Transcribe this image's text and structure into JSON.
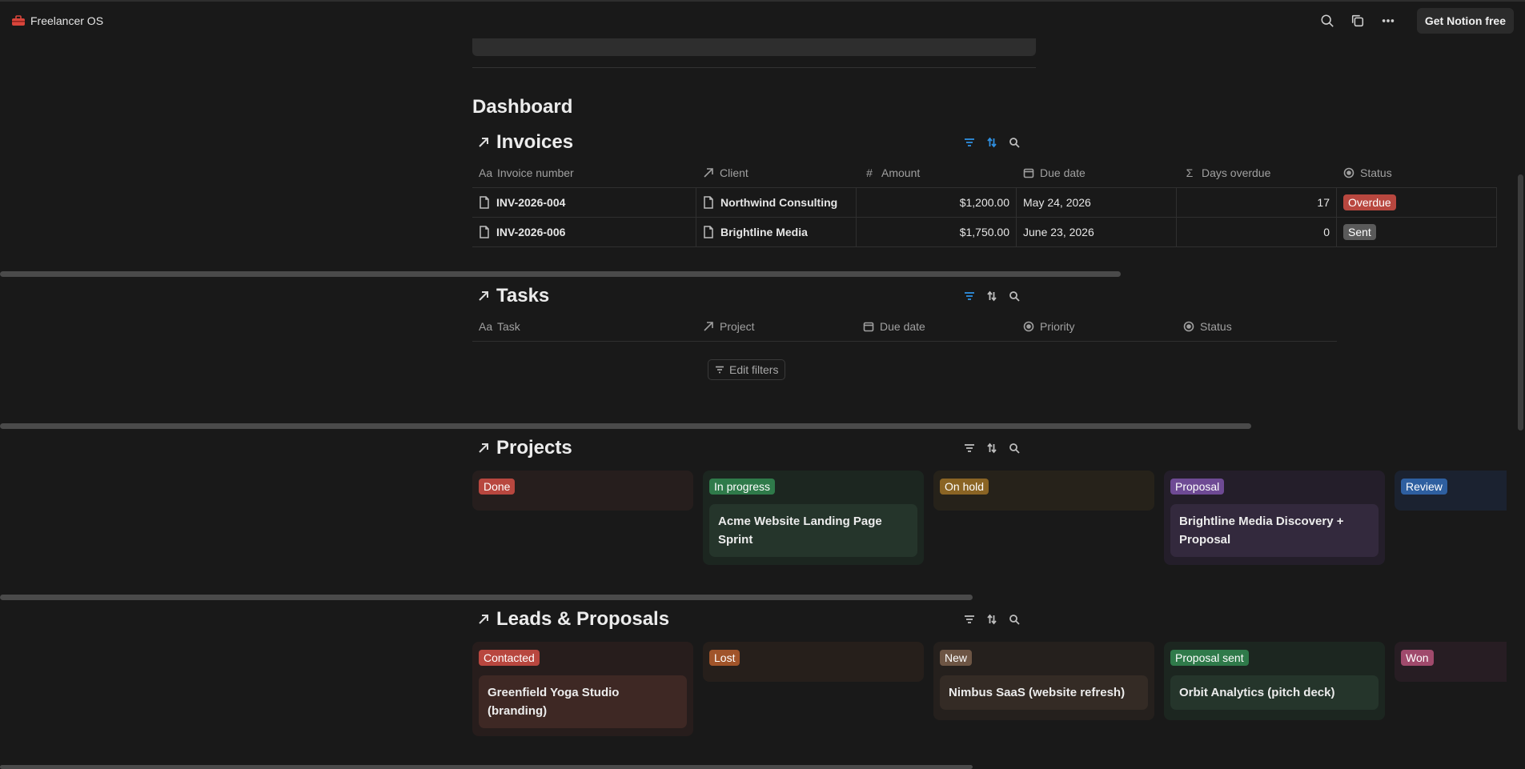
{
  "app": {
    "title": "Freelancer OS",
    "get_notion": "Get Notion free"
  },
  "dashboard": {
    "title": "Dashboard"
  },
  "invoices": {
    "title": "Invoices",
    "columns": [
      "Invoice number",
      "Client",
      "Amount",
      "Due date",
      "Days overdue",
      "Status"
    ],
    "rows": [
      {
        "invoice": "INV-2026-004",
        "client": "Northwind Consulting",
        "amount": "$1,200.00",
        "due": "May 24, 2026",
        "days": "17",
        "status": "Overdue"
      },
      {
        "invoice": "INV-2026-006",
        "client": "Brightline Media",
        "amount": "$1,750.00",
        "due": "June 23, 2026",
        "days": "0",
        "status": "Sent"
      }
    ]
  },
  "tasks": {
    "title": "Tasks",
    "columns": [
      "Task",
      "Project",
      "Due date",
      "Priority",
      "Status"
    ],
    "edit_filters": "Edit filters"
  },
  "projects": {
    "title": "Projects",
    "groups": [
      {
        "label": "Done",
        "color": "#b8473f",
        "cards": []
      },
      {
        "label": "In progress",
        "color": "#2f7a4a",
        "cards": [
          "Acme Website Landing Page Sprint"
        ]
      },
      {
        "label": "On hold",
        "color": "#8a6424",
        "cards": []
      },
      {
        "label": "Proposal",
        "color": "#6e4a94",
        "cards": [
          "Brightline Media Discovery + Proposal"
        ]
      },
      {
        "label": "Review",
        "color": "#2e5fa0",
        "cards": []
      }
    ]
  },
  "leads": {
    "title": "Leads & Proposals",
    "groups": [
      {
        "label": "Contacted",
        "color": "#b8473f",
        "cards": [
          "Greenfield Yoga Studio (branding)"
        ]
      },
      {
        "label": "Lost",
        "color": "#a0542a",
        "cards": []
      },
      {
        "label": "New",
        "color": "#6d5544",
        "cards": [
          "Nimbus SaaS (website refresh)"
        ]
      },
      {
        "label": "Proposal sent",
        "color": "#2f7a4a",
        "cards": [
          "Orbit Analytics (pitch deck)"
        ]
      },
      {
        "label": "Won",
        "color": "#a04a6c",
        "cards": []
      }
    ]
  },
  "colors": {
    "accent": "#2f8fe0",
    "overdue": "#b8473f",
    "sent": "#5a5a5a"
  }
}
